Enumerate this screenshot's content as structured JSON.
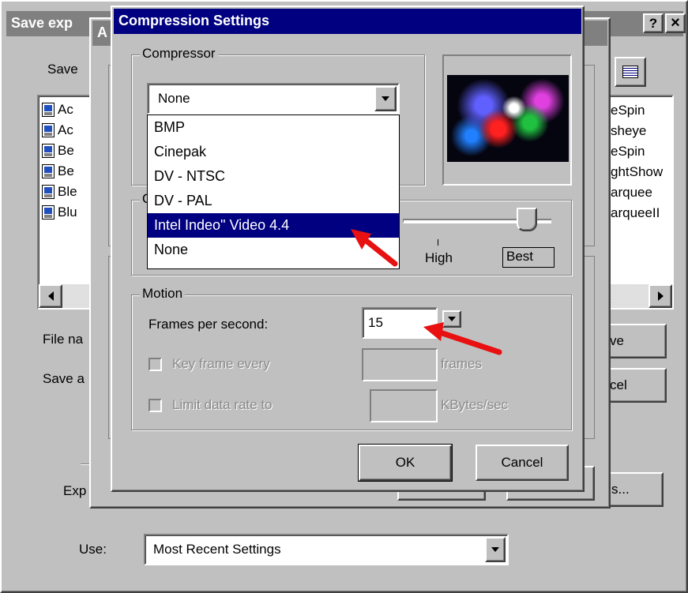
{
  "background_window": {
    "title": "Save exp",
    "help_label": "?",
    "close_label": "×",
    "save_label": "Save",
    "file_name_label": "File na",
    "save_as_label": "Save a",
    "export_label": "Exp",
    "options_button_label": "s...",
    "save_button_label": "ve",
    "cancel_button_label": "cel",
    "use_label": "Use:",
    "use_value": "Most Recent Settings",
    "files_left": [
      "Ac",
      "Ac",
      "Be",
      "Be",
      "Ble",
      "Blu"
    ],
    "files_right": [
      "eSpin",
      "sheye",
      "eSpin",
      "ghtShow",
      "arquee",
      "arqueeII"
    ]
  },
  "middle_window": {
    "title_fragment": "A"
  },
  "dialog": {
    "title": "Compression Settings",
    "compressor": {
      "legend": "Compressor",
      "selected": "None",
      "options": [
        "BMP",
        "Cinepak",
        "DV - NTSC",
        "DV - PAL",
        "Intel Indeo\" Video 4.4",
        "None"
      ],
      "highlighted_index": 4
    },
    "quality": {
      "legend": "Q",
      "high_label": "High",
      "best_label": "Best"
    },
    "motion": {
      "legend": "Motion",
      "fps_label": "Frames per second:",
      "fps_value": "15",
      "keyframe_label": "Key frame every",
      "keyframe_unit": "frames",
      "datarate_label": "Limit data rate to",
      "datarate_unit": "KBytes/sec"
    },
    "ok_label": "OK",
    "cancel_label": "Cancel"
  },
  "annotation_color": "#e81010"
}
